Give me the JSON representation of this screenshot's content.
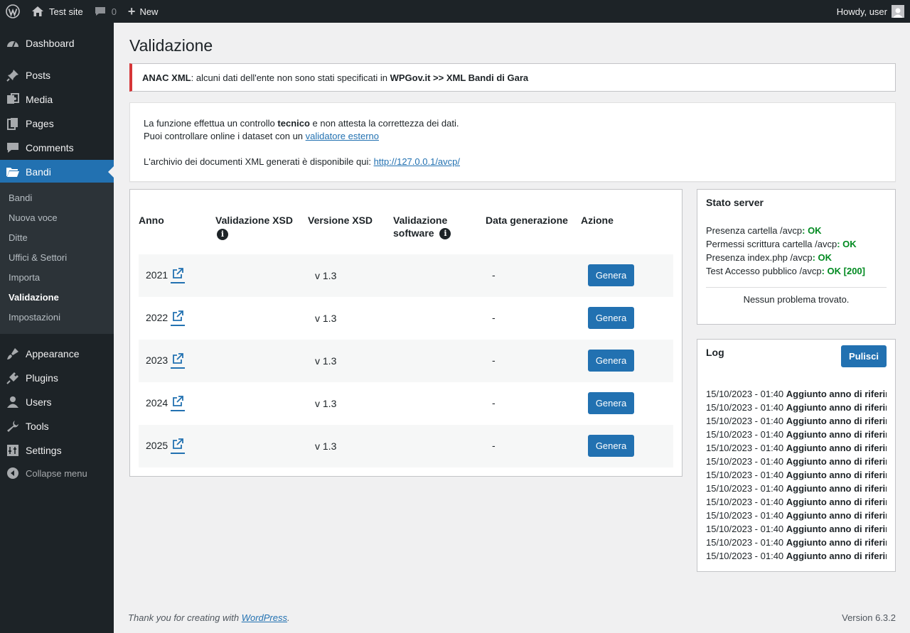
{
  "adminbar": {
    "site_name": "Test site",
    "comments_count": "0",
    "new_label": "New",
    "howdy": "Howdy, user"
  },
  "sidebar": {
    "items": [
      {
        "label": "Dashboard",
        "icon": "dashboard-icon"
      },
      {
        "label": "Posts",
        "icon": "pin-icon"
      },
      {
        "label": "Media",
        "icon": "media-icon"
      },
      {
        "label": "Pages",
        "icon": "pages-icon"
      },
      {
        "label": "Comments",
        "icon": "comment-icon"
      },
      {
        "label": "Bandi",
        "icon": "folder-open-icon"
      },
      {
        "label": "Appearance",
        "icon": "brush-icon"
      },
      {
        "label": "Plugins",
        "icon": "plugin-icon"
      },
      {
        "label": "Users",
        "icon": "user-icon"
      },
      {
        "label": "Tools",
        "icon": "wrench-icon"
      },
      {
        "label": "Settings",
        "icon": "settings-icon"
      }
    ],
    "submenu": [
      "Bandi",
      "Nuova voce",
      "Ditte",
      "Uffici & Settori",
      "Importa",
      "Validazione",
      "Impostazioni"
    ],
    "collapse_label": "Collapse menu"
  },
  "page": {
    "title": "Validazione",
    "notice": {
      "bold_prefix": "ANAC XML",
      "text": ": alcuni dati dell'ente non sono stati specificati in ",
      "bold_suffix": "WPGov.it >> XML Bandi di Gara"
    },
    "info": {
      "line1_a": "La funzione effettua un controllo ",
      "line1_bold": "tecnico",
      "line1_b": " e non attesta la correttezza dei dati.",
      "line2_a": "Puoi controllare online i dataset con un ",
      "line2_link": "validatore esterno",
      "line3_a": "L'archivio dei documenti XML generati è disponibile qui: ",
      "line3_link": "http://127.0.0.1/avcp/"
    }
  },
  "table": {
    "headers": {
      "anno": "Anno",
      "val_xsd": "Validazione XSD",
      "ver_xsd": "Versione XSD",
      "val_sw_1": "Validazione",
      "val_sw_2": "software",
      "data_gen": "Data generazione",
      "azione": "Azione"
    },
    "rows": [
      {
        "year": "2021",
        "version": "v 1.3",
        "date": "-",
        "action": "Genera"
      },
      {
        "year": "2022",
        "version": "v 1.3",
        "date": "-",
        "action": "Genera"
      },
      {
        "year": "2023",
        "version": "v 1.3",
        "date": "-",
        "action": "Genera"
      },
      {
        "year": "2024",
        "version": "v 1.3",
        "date": "-",
        "action": "Genera"
      },
      {
        "year": "2025",
        "version": "v 1.3",
        "date": "-",
        "action": "Genera"
      }
    ]
  },
  "server": {
    "title": "Stato server",
    "lines": [
      {
        "label": "Presenza cartella /avcp",
        "status": ": OK"
      },
      {
        "label": "Permessi scrittura cartella /avcp",
        "status": ": OK"
      },
      {
        "label": "Presenza index.php /avcp",
        "status": ": OK"
      },
      {
        "label": "Test Accesso pubblico /avcp",
        "status": ": OK [200]"
      }
    ],
    "summary": "Nessun problema trovato."
  },
  "log": {
    "title": "Log",
    "clear_label": "Pulisci",
    "entries": [
      {
        "time": "15/10/2023 - 01:40 ",
        "msg": "Aggiunto anno di riferimento"
      },
      {
        "time": "15/10/2023 - 01:40 ",
        "msg": "Aggiunto anno di riferimento"
      },
      {
        "time": "15/10/2023 - 01:40 ",
        "msg": "Aggiunto anno di riferimento"
      },
      {
        "time": "15/10/2023 - 01:40 ",
        "msg": "Aggiunto anno di riferimento"
      },
      {
        "time": "15/10/2023 - 01:40 ",
        "msg": "Aggiunto anno di riferimento"
      },
      {
        "time": "15/10/2023 - 01:40 ",
        "msg": "Aggiunto anno di riferimento"
      },
      {
        "time": "15/10/2023 - 01:40 ",
        "msg": "Aggiunto anno di riferimento"
      },
      {
        "time": "15/10/2023 - 01:40 ",
        "msg": "Aggiunto anno di riferimento"
      },
      {
        "time": "15/10/2023 - 01:40 ",
        "msg": "Aggiunto anno di riferimento"
      },
      {
        "time": "15/10/2023 - 01:40 ",
        "msg": "Aggiunto anno di riferimento"
      },
      {
        "time": "15/10/2023 - 01:40 ",
        "msg": "Aggiunto anno di riferimento"
      },
      {
        "time": "15/10/2023 - 01:40 ",
        "msg": "Aggiunto anno di riferimento"
      },
      {
        "time": "15/10/2023 - 01:40 ",
        "msg": "Aggiunto anno di riferimento"
      }
    ]
  },
  "footer": {
    "thanks_a": "Thank you for creating with ",
    "thanks_link": "WordPress",
    "thanks_b": ".",
    "version": "Version 6.3.2"
  }
}
